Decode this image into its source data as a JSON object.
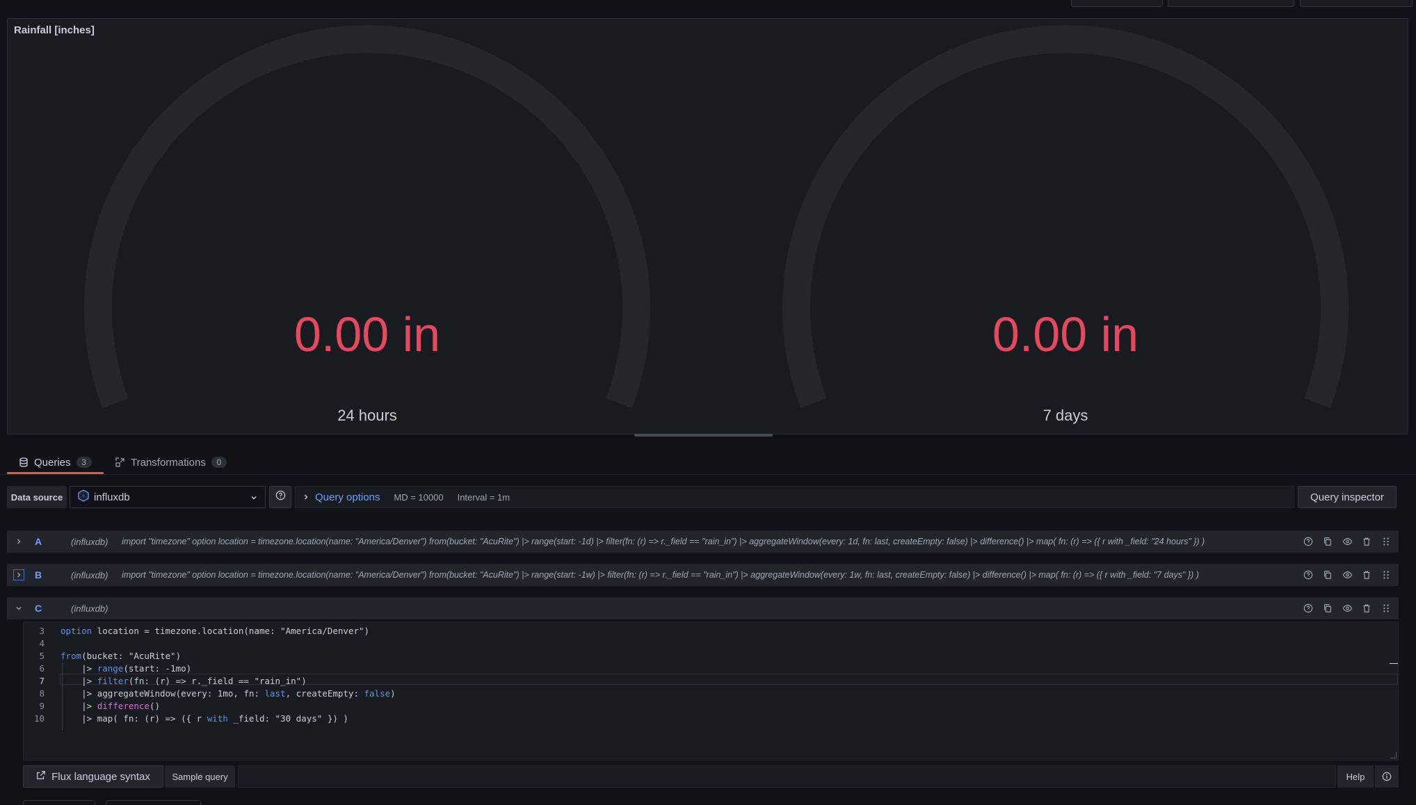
{
  "panel": {
    "title": "Rainfall [inches]",
    "gauges": [
      {
        "value": "0.00 in",
        "label": "24 hours"
      },
      {
        "value": "0.00 in",
        "label": "7 days"
      }
    ]
  },
  "tabs": [
    {
      "label": "Queries",
      "count": "3",
      "active": true
    },
    {
      "label": "Transformations",
      "count": "0",
      "active": false
    }
  ],
  "datasource": {
    "label": "Data source",
    "selected": "influxdb"
  },
  "query_options": {
    "title": "Query options",
    "md": "MD = 10000",
    "interval": "Interval = 1m"
  },
  "query_inspector_label": "Query inspector",
  "queries": [
    {
      "ref": "A",
      "datasource": "(influxdb)",
      "text": "import \"timezone\" option location = timezone.location(name: \"America/Denver\") from(bucket: \"AcuRite\") |> range(start: -1d) |> filter(fn: (r) => r._field == \"rain_in\") |> aggregateWindow(every: 1d, fn: last, createEmpty: false) |> difference() |> map( fn: (r) => ({ r with _field: \"24 hours\" }) )"
    },
    {
      "ref": "B",
      "datasource": "(influxdb)",
      "text": "import \"timezone\" option location = timezone.location(name: \"America/Denver\") from(bucket: \"AcuRite\") |> range(start: -1w) |> filter(fn: (r) => r._field == \"rain_in\") |> aggregateWindow(every: 1w, fn: last, createEmpty: false) |> difference() |> map( fn: (r) => ({ r with _field: \"7 days\" }) )"
    },
    {
      "ref": "C",
      "datasource": "(influxdb)",
      "text": ""
    }
  ],
  "editor": {
    "lines": [
      {
        "n": "3",
        "code": "option location = timezone.location(name: \"America/Denver\")"
      },
      {
        "n": "4",
        "code": ""
      },
      {
        "n": "5",
        "code": "from(bucket: \"AcuRite\")"
      },
      {
        "n": "6",
        "code": "    |> range(start: -1mo)"
      },
      {
        "n": "7",
        "code": "    |> filter(fn: (r) => r._field == \"rain_in\")"
      },
      {
        "n": "8",
        "code": "    |> aggregateWindow(every: 1mo, fn: last, createEmpty: false)"
      },
      {
        "n": "9",
        "code": "    |> difference()"
      },
      {
        "n": "10",
        "code": "    |> map( fn: (r) => ({ r with _field: \"30 days\" }) )"
      }
    ],
    "active_line": "7"
  },
  "footer": {
    "flux_syntax": "Flux language syntax",
    "sample_query": "Sample query",
    "help": "Help"
  },
  "colors": {
    "gauge_value": "#e5485f",
    "link_blue": "#6e9fff",
    "active_tab": "#f05a28"
  }
}
